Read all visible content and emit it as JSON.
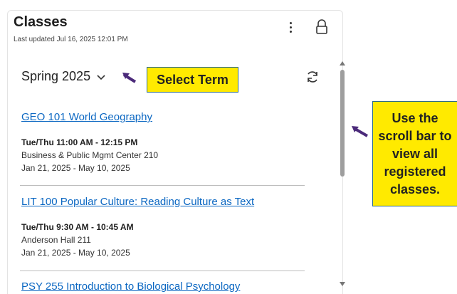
{
  "widget": {
    "title": "Classes",
    "updated": "Last updated Jul 16, 2025 12:01 PM",
    "term": "Spring 2025"
  },
  "callouts": {
    "term": "Select Term",
    "scroll": "Use the scroll bar to view all registered classes."
  },
  "classes": [
    {
      "name": "GEO 101 World Geography",
      "time": "Tue/Thu 11:00 AM - 12:15 PM",
      "location": "Business & Public Mgmt Center 210",
      "dates": "Jan 21, 2025 - May 10, 2025"
    },
    {
      "name": "LIT 100 Popular Culture: Reading Culture as Text",
      "time": "Tue/Thu 9:30 AM - 10:45 AM",
      "location": "Anderson Hall 211",
      "dates": "Jan 21, 2025 - May 10, 2025"
    },
    {
      "name": "PSY 255 Introduction to Biological Psychology"
    }
  ],
  "icons": {
    "menu": "kebab-menu-icon",
    "lock": "lock-icon",
    "chevron": "chevron-down-icon",
    "refresh": "refresh-icon",
    "arrow": "pointer-arrow-icon"
  },
  "colors": {
    "link": "#0b67c2",
    "callout_bg": "#ffea00",
    "callout_border": "#2b6a8b",
    "arrow": "#4b2a7a"
  }
}
